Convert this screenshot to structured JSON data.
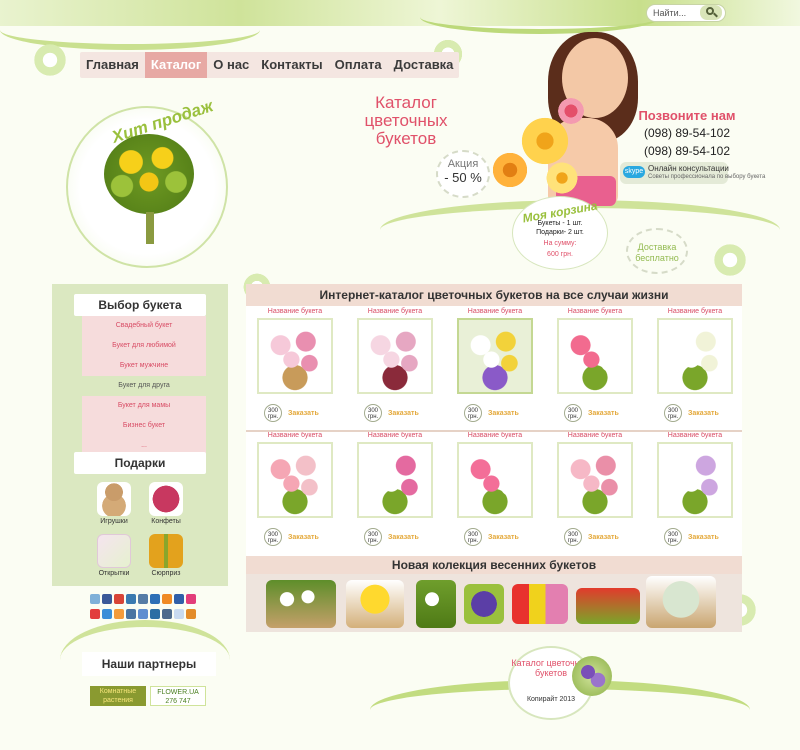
{
  "search": {
    "placeholder": "Найти..."
  },
  "nav": {
    "items": [
      "Главная",
      "Каталог",
      "О нас",
      "Контакты",
      "Оплата",
      "Доставка"
    ],
    "active": "Каталог"
  },
  "hit": {
    "title": "Хит продаж"
  },
  "header": {
    "catalog_title": "Каталог цветочных букетов",
    "akcia_label": "Акция",
    "akcia_value": "- 50 %",
    "call_title": "Позвоните нам",
    "phones": [
      "(098) 89-54-102",
      "(098) 89-54-102"
    ],
    "skype_logo": "skype",
    "skype_label": "Онлайн консультации",
    "skype_sub": "Советы профессионала по выбору букета"
  },
  "cart": {
    "title": "Моя корзина",
    "line1": "Букеты - 1 шт.",
    "line2": "Подарки- 2 шт.",
    "sum_label": "На сумму:",
    "sum_value": "600 грн."
  },
  "delivery": {
    "text": "Доставка бесплатно"
  },
  "sidebar": {
    "title": "Выбор букета",
    "items": [
      "Свадебный букет",
      "Букет для любимой",
      "Букет мужчине",
      "Букет для друга",
      "Букет для мамы",
      "Бизнес букет",
      "..."
    ],
    "gifts_title": "Подарки",
    "gifts": [
      "Игрушки",
      "Конфеты",
      "Открытки",
      "Сюрприз"
    ]
  },
  "partners": {
    "title": "Наши партнеры",
    "items": [
      "Комнатные растения",
      "FLOWER.UA 276 747"
    ]
  },
  "catalog": {
    "title": "Интернет-каталог цветочных букетов на все случаи жизни",
    "name": "Название букета",
    "price": "300",
    "currency": "грн.",
    "order": "Заказать"
  },
  "new_collection": {
    "title": "Новая колекция весенних букетов"
  },
  "footer": {
    "title": "Каталог цветочных букетов",
    "copyright": "Копирайт 2013"
  },
  "colors": {
    "accent_pink": "#e0516a",
    "accent_green": "#9ac03d",
    "order_orange": "#e4a93b"
  }
}
